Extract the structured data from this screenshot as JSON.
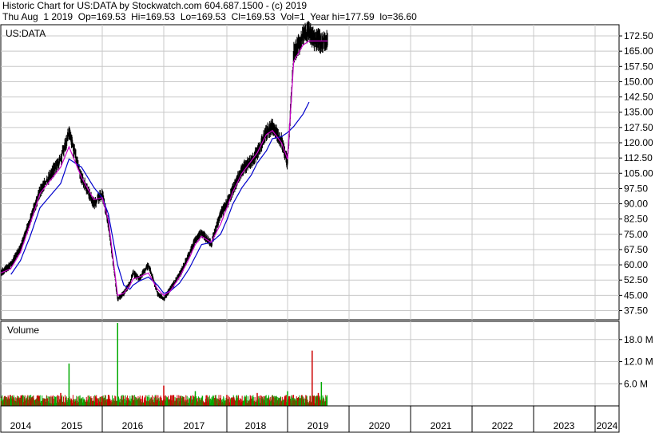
{
  "header": {
    "line1": "Historic Chart for US:DATA by Stockwatch.com 604.687.1500 - (c) 2019",
    "line2": "Thu Aug  1 2019  Op=169.53  Hi=169.53  Lo=169.53  Cl=169.53  Vol=1  Year hi=177.59  lo=36.60"
  },
  "price_panel": {
    "symbol_label": "US:DATA",
    "y_ticks": [
      "172.50",
      "165.00",
      "157.50",
      "150.00",
      "142.50",
      "135.00",
      "127.50",
      "120.00",
      "112.50",
      "105.00",
      "97.50",
      "90.00",
      "82.50",
      "75.00",
      "67.50",
      "60.00",
      "52.50",
      "45.00",
      "37.50"
    ]
  },
  "volume_panel": {
    "label": "Volume",
    "y_ticks": [
      "18.0 M",
      "12.0 M",
      "6.0 M"
    ]
  },
  "x_axis": {
    "year_labels": [
      "2014",
      "2015",
      "2016",
      "2017",
      "2018",
      "2019",
      "2020",
      "2021",
      "2022",
      "2023",
      "2024"
    ]
  },
  "colors": {
    "price_bars": "#000000",
    "ma_short": "#cc00cc",
    "ma_long": "#0000cc",
    "volume_up": "#00aa00",
    "volume_down": "#cc0000",
    "grid": "#c8c8c8"
  },
  "chart_data": [
    {
      "type": "line",
      "title": "US:DATA",
      "x": [
        2013.75,
        2014.0,
        2014.25,
        2014.5,
        2014.75,
        2015.0,
        2015.1,
        2015.25,
        2015.4,
        2015.5,
        2015.6,
        2015.75,
        2015.85,
        2015.95,
        2016.0,
        2016.1,
        2016.25,
        2016.4,
        2016.5,
        2016.6,
        2016.75,
        2016.9,
        2017.0,
        2017.1,
        2017.25,
        2017.4,
        2017.5,
        2017.6,
        2017.75,
        2017.9,
        2018.0,
        2018.15,
        2018.25,
        2018.4,
        2018.5,
        2018.6,
        2018.75,
        2018.85,
        2018.95,
        2019.0,
        2019.05,
        2019.1,
        2019.15
      ],
      "series": [
        {
          "name": "",
          "values": [
            56,
            60,
            68,
            82,
            96,
            112,
            125,
            103,
            90,
            95,
            80,
            43,
            46,
            51,
            56,
            53,
            60,
            46,
            43,
            48,
            55,
            65,
            72,
            76,
            70,
            85,
            90,
            97,
            107,
            111,
            115,
            125,
            128,
            121,
            110,
            164,
            172,
            175,
            170,
            171,
            169,
            170,
            169.5
          ]
        }
      ],
      "moving_averages": {
        "short": [
          56,
          58,
          66,
          80,
          95,
          108,
          118,
          103,
          92,
          93,
          82,
          45,
          46,
          50,
          53,
          54,
          56,
          48,
          45,
          47,
          54,
          63,
          70,
          74,
          71,
          80,
          88,
          96,
          105,
          111,
          115,
          124,
          126,
          120,
          112,
          160,
          168,
          170,
          170,
          170,
          170,
          170,
          170
        ],
        "long": [
          null,
          55,
          62,
          74,
          88,
          100,
          112,
          108,
          98,
          93,
          85,
          60,
          50,
          48,
          50,
          52,
          54,
          50,
          46,
          47,
          51,
          58,
          64,
          70,
          71,
          75,
          82,
          90,
          98,
          104,
          110,
          116,
          122,
          123,
          125,
          128,
          134,
          140,
          null,
          null,
          null,
          null,
          null
        ]
      },
      "ylim": [
        33,
        178
      ],
      "xlim": [
        2013.75,
        2024.75
      ]
    },
    {
      "type": "bar",
      "title": "Volume",
      "x": [
        2014.0,
        2014.5,
        2015.0,
        2015.1,
        2015.5,
        2015.6,
        2015.75,
        2016.0,
        2016.5,
        2017.0,
        2017.5,
        2018.0,
        2018.5,
        2018.9,
        2019.0,
        2019.05
      ],
      "values": [
        1.8,
        2.0,
        3.5,
        11.5,
        2.2,
        3.0,
        22.5,
        2.8,
        5.5,
        4.0,
        3.0,
        3.5,
        4.0,
        15.0,
        3.5,
        6.5
      ],
      "ylim": [
        0,
        22.5
      ]
    }
  ]
}
